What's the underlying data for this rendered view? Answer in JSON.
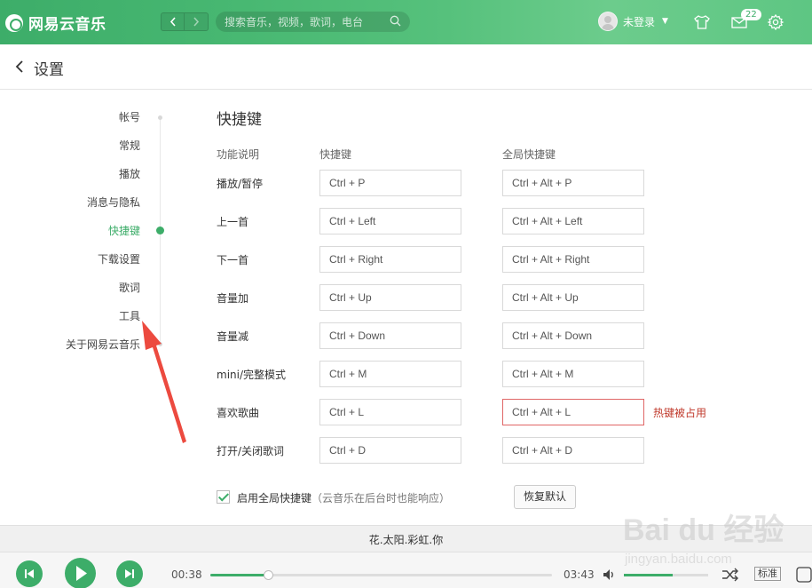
{
  "app": {
    "name": "网易云音乐",
    "search_placeholder": "搜索音乐，视频，歌词，电台",
    "user_label": "未登录",
    "message_count": "22",
    "brand_color": "#3dad69"
  },
  "header": {
    "title": "设置"
  },
  "sidebar": {
    "items": [
      {
        "label": "帐号",
        "active": false
      },
      {
        "label": "常规",
        "active": false
      },
      {
        "label": "播放",
        "active": false
      },
      {
        "label": "消息与隐私",
        "active": false
      },
      {
        "label": "快捷键",
        "active": true
      },
      {
        "label": "下载设置",
        "active": false
      },
      {
        "label": "歌词",
        "active": false
      },
      {
        "label": "工具",
        "active": false
      },
      {
        "label": "关于网易云音乐",
        "active": false
      }
    ]
  },
  "shortcuts": {
    "title": "快捷键",
    "columns": [
      "功能说明",
      "快捷键",
      "全局快捷键"
    ],
    "rows": [
      {
        "label": "播放/暂停",
        "key": "Ctrl + P",
        "global": "Ctrl + Alt + P",
        "conflict": ""
      },
      {
        "label": "上一首",
        "key": "Ctrl + Left",
        "global": "Ctrl + Alt + Left",
        "conflict": ""
      },
      {
        "label": "下一首",
        "key": "Ctrl + Right",
        "global": "Ctrl + Alt + Right",
        "conflict": ""
      },
      {
        "label": "音量加",
        "key": "Ctrl + Up",
        "global": "Ctrl + Alt + Up",
        "conflict": ""
      },
      {
        "label": "音量减",
        "key": "Ctrl + Down",
        "global": "Ctrl + Alt + Down",
        "conflict": ""
      },
      {
        "label": "mini/完整模式",
        "key": "Ctrl + M",
        "global": "Ctrl + Alt + M",
        "conflict": ""
      },
      {
        "label": "喜欢歌曲",
        "key": "Ctrl + L",
        "global": "Ctrl + Alt + L",
        "conflict": "热键被占用"
      },
      {
        "label": "打开/关闭歌词",
        "key": "Ctrl + D",
        "global": "Ctrl + Alt + D",
        "conflict": ""
      }
    ],
    "enable_global_label": "启用全局快捷键",
    "enable_global_note": "（云音乐在后台时也能响应）",
    "enable_global_checked": true,
    "reset_label": "恢复默认",
    "conflict_color": "#c0392b"
  },
  "player": {
    "song_title": "花.太阳.彩虹.你",
    "elapsed": "00:38",
    "duration": "03:43",
    "progress": 0.17,
    "volume": 0.58,
    "quality_label": "标准"
  },
  "watermark": {
    "text": "Bai du 经验",
    "url": "jingyan.baidu.com"
  }
}
